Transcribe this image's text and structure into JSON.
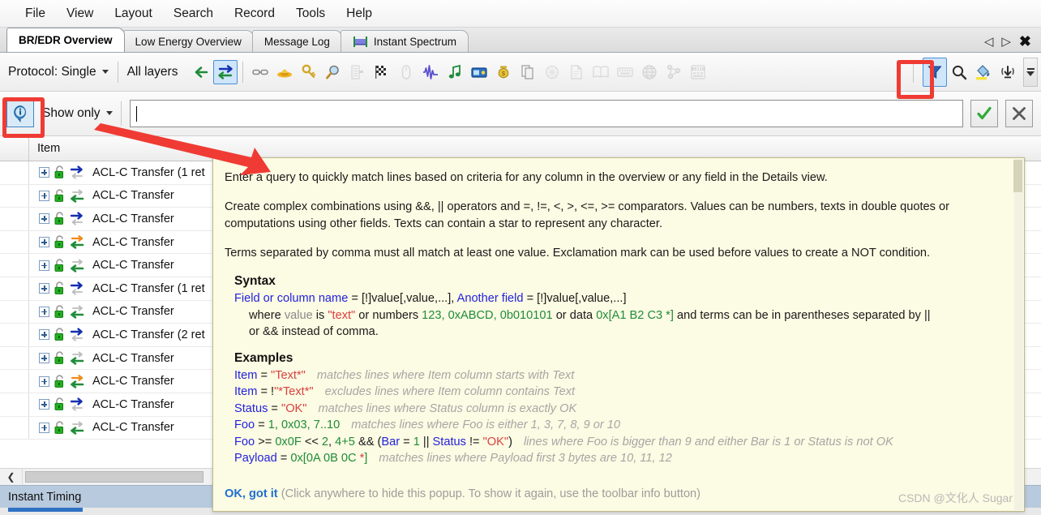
{
  "menu": {
    "items": [
      "File",
      "View",
      "Layout",
      "Search",
      "Record",
      "Tools",
      "Help"
    ]
  },
  "tabs": {
    "items": [
      {
        "label": "BR/EDR Overview",
        "active": true,
        "icon": ""
      },
      {
        "label": "Low Energy Overview",
        "active": false,
        "icon": ""
      },
      {
        "label": "Message Log",
        "active": false,
        "icon": ""
      },
      {
        "label": "Instant Spectrum",
        "active": false,
        "icon": "spectrum-icon"
      }
    ],
    "nav_prev": "◁",
    "nav_next": "▷",
    "close": "✖"
  },
  "toolbar": {
    "protocol_label": "Protocol: Single",
    "layers_label": "All layers",
    "icons": [
      "arrow-left-green-icon",
      "arrow-bidirectional-icon",
      "link-icon",
      "sombrero-icon",
      "key-icon",
      "magnifier-icon",
      "list-icon",
      "checkered-flag-icon",
      "mouse-icon",
      "waveform-icon",
      "music-note-icon",
      "radio-icon",
      "money-bag-icon",
      "copy-icon",
      "chip-icon",
      "page-icon",
      "book-icon",
      "keyboard-small-icon",
      "globe-icon",
      "network-icon",
      "binary-keypad-icon"
    ],
    "right_icons": [
      "filter-icon",
      "search-icon",
      "paint-bucket-icon",
      "broadcast-down-icon"
    ],
    "selected_icon": "arrow-bidirectional-icon",
    "highlighted_icon": "filter-icon",
    "overflow": "overflow-chevron-icon"
  },
  "filterbar": {
    "info_button": "info-icon",
    "show_only_label": "Show only",
    "query_value": "",
    "query_placeholder": "",
    "accept": "checkmark-icon",
    "cancel": "cross-icon"
  },
  "list": {
    "columns": [
      "Item"
    ],
    "rows": [
      {
        "item": "ACL-C Transfer (1 ret",
        "dir": "tx",
        "lock": "unlocked-icon"
      },
      {
        "item": "ACL-C Transfer",
        "dir": "rx",
        "lock": "unlocked-icon"
      },
      {
        "item": "ACL-C Transfer",
        "dir": "tx",
        "lock": "unlocked-icon"
      },
      {
        "item": "ACL-C Transfer",
        "dir": "rx-orange",
        "lock": "unlocked-icon"
      },
      {
        "item": "ACL-C Transfer",
        "dir": "rx",
        "lock": "unlocked-icon"
      },
      {
        "item": "ACL-C Transfer (1 ret",
        "dir": "tx",
        "lock": "unlocked-icon"
      },
      {
        "item": "ACL-C Transfer",
        "dir": "rx",
        "lock": "unlocked-icon"
      },
      {
        "item": "ACL-C Transfer (2 ret",
        "dir": "tx",
        "lock": "unlocked-icon"
      },
      {
        "item": "ACL-C Transfer",
        "dir": "rx",
        "lock": "unlocked-icon"
      },
      {
        "item": "ACL-C Transfer",
        "dir": "rx-orange",
        "lock": "unlocked-icon"
      },
      {
        "item": "ACL-C Transfer",
        "dir": "tx",
        "lock": "unlocked-icon"
      },
      {
        "item": "ACL-C Transfer",
        "dir": "rx",
        "lock": "unlocked-icon"
      }
    ],
    "scroll_left_arrow": "❮"
  },
  "status": {
    "label": "Instant Timing"
  },
  "popup": {
    "paragraphs": [
      "Enter a query to quickly match lines based on criteria for any column in the overview or any field in the Details view.",
      "Create complex combinations using &&, || operators and =, !=, <, >, <=, >= comparators. Values can be numbers, texts in double quotes or computations using other fields. Texts can contain a star to represent any character.",
      "Terms separated by comma must all match at least one value. Exclamation mark can be used before values to create a NOT condition."
    ],
    "syntax_heading": "Syntax",
    "syntax": {
      "line1_field1": "Field or column name",
      "line1_mid": " = [!]value[,value,...], ",
      "line1_field2": "Another field",
      "line1_end": " = [!]value[,value,...]",
      "line2_where": "where ",
      "line2_value": "value",
      "line2_is": " is ",
      "line2_text": "\"text\"",
      "line2_or": " or numbers ",
      "line2_nums": "123, 0xABCD, 0b010101",
      "line2_or2": " or data ",
      "line2_data": "0x[A1 B2 C3 *]",
      "line2_tail": " and terms can be in parentheses separated by ||",
      "line3": "or && instead of comma."
    },
    "examples_heading": "Examples",
    "examples": [
      {
        "field": "Item",
        "op": " = ",
        "value": "\"Text*\"",
        "value_color": "text",
        "comment": "matches lines where Item column starts with Text"
      },
      {
        "field": "Item",
        "op": " = !",
        "value": "\"*Text*\"",
        "value_color": "text",
        "comment": "excludes lines where Item column contains Text"
      },
      {
        "field": "Status",
        "op": " = ",
        "value": "\"OK\"",
        "value_color": "text",
        "comment": "matches lines where Status column is exactly OK"
      },
      {
        "field": "Foo",
        "op": " = ",
        "value": "1, 0x03, 7..10",
        "value_color": "num",
        "comment": "matches lines where Foo is either 1, 3, 7, 8, 9 or 10"
      },
      {
        "field": "Foo",
        "op": " >= ",
        "value": "0x0F",
        "value_color": "num",
        "comment": ""
      },
      {
        "field": "Payload",
        "op": " = ",
        "value": "0x[0A 0B 0C *]",
        "value_color": "num",
        "comment": "matches lines where Payload first 3 bytes are 10, 11, 12"
      }
    ],
    "complex_example": {
      "f1": "Foo",
      "p1": " >= ",
      "n1": "0x0F",
      "p2": " << ",
      "n2": "2",
      "p3": ", ",
      "n3": "4+5",
      "p4": " && (",
      "f2": "Bar",
      "p5": " = ",
      "n4": "1",
      "p6": " || ",
      "f3": "Status",
      "p7": " != ",
      "t1": "\"OK\"",
      "p8": ")",
      "comment": "lines where Foo is bigger than 9 and either Bar is 1 or Status is not OK"
    },
    "payload_example": {
      "field": "Payload",
      "op": " = ",
      "prefix": "0x[",
      "bytes": "0A 0B 0C ",
      "star": "*",
      "suffix": "]",
      "comment": "matches lines where Payload first 3 bytes are 10, 11, 12"
    },
    "footer_link": "OK, got it",
    "footer_rest": " (Click anywhere to hide this popup. To show it again, use the toolbar info button)",
    "watermark": "CSDN @文化人 Sugar"
  },
  "colors": {
    "field_blue": "#2222dd",
    "text_red": "#d94040",
    "number_green": "#1f8c3a",
    "comment_gray": "#a6a6a6",
    "popup_bg": "#fcfbe3",
    "annotation_red": "#ef3b34",
    "selection_blue": "#cfe5fa",
    "status_blue": "#b8cade"
  }
}
